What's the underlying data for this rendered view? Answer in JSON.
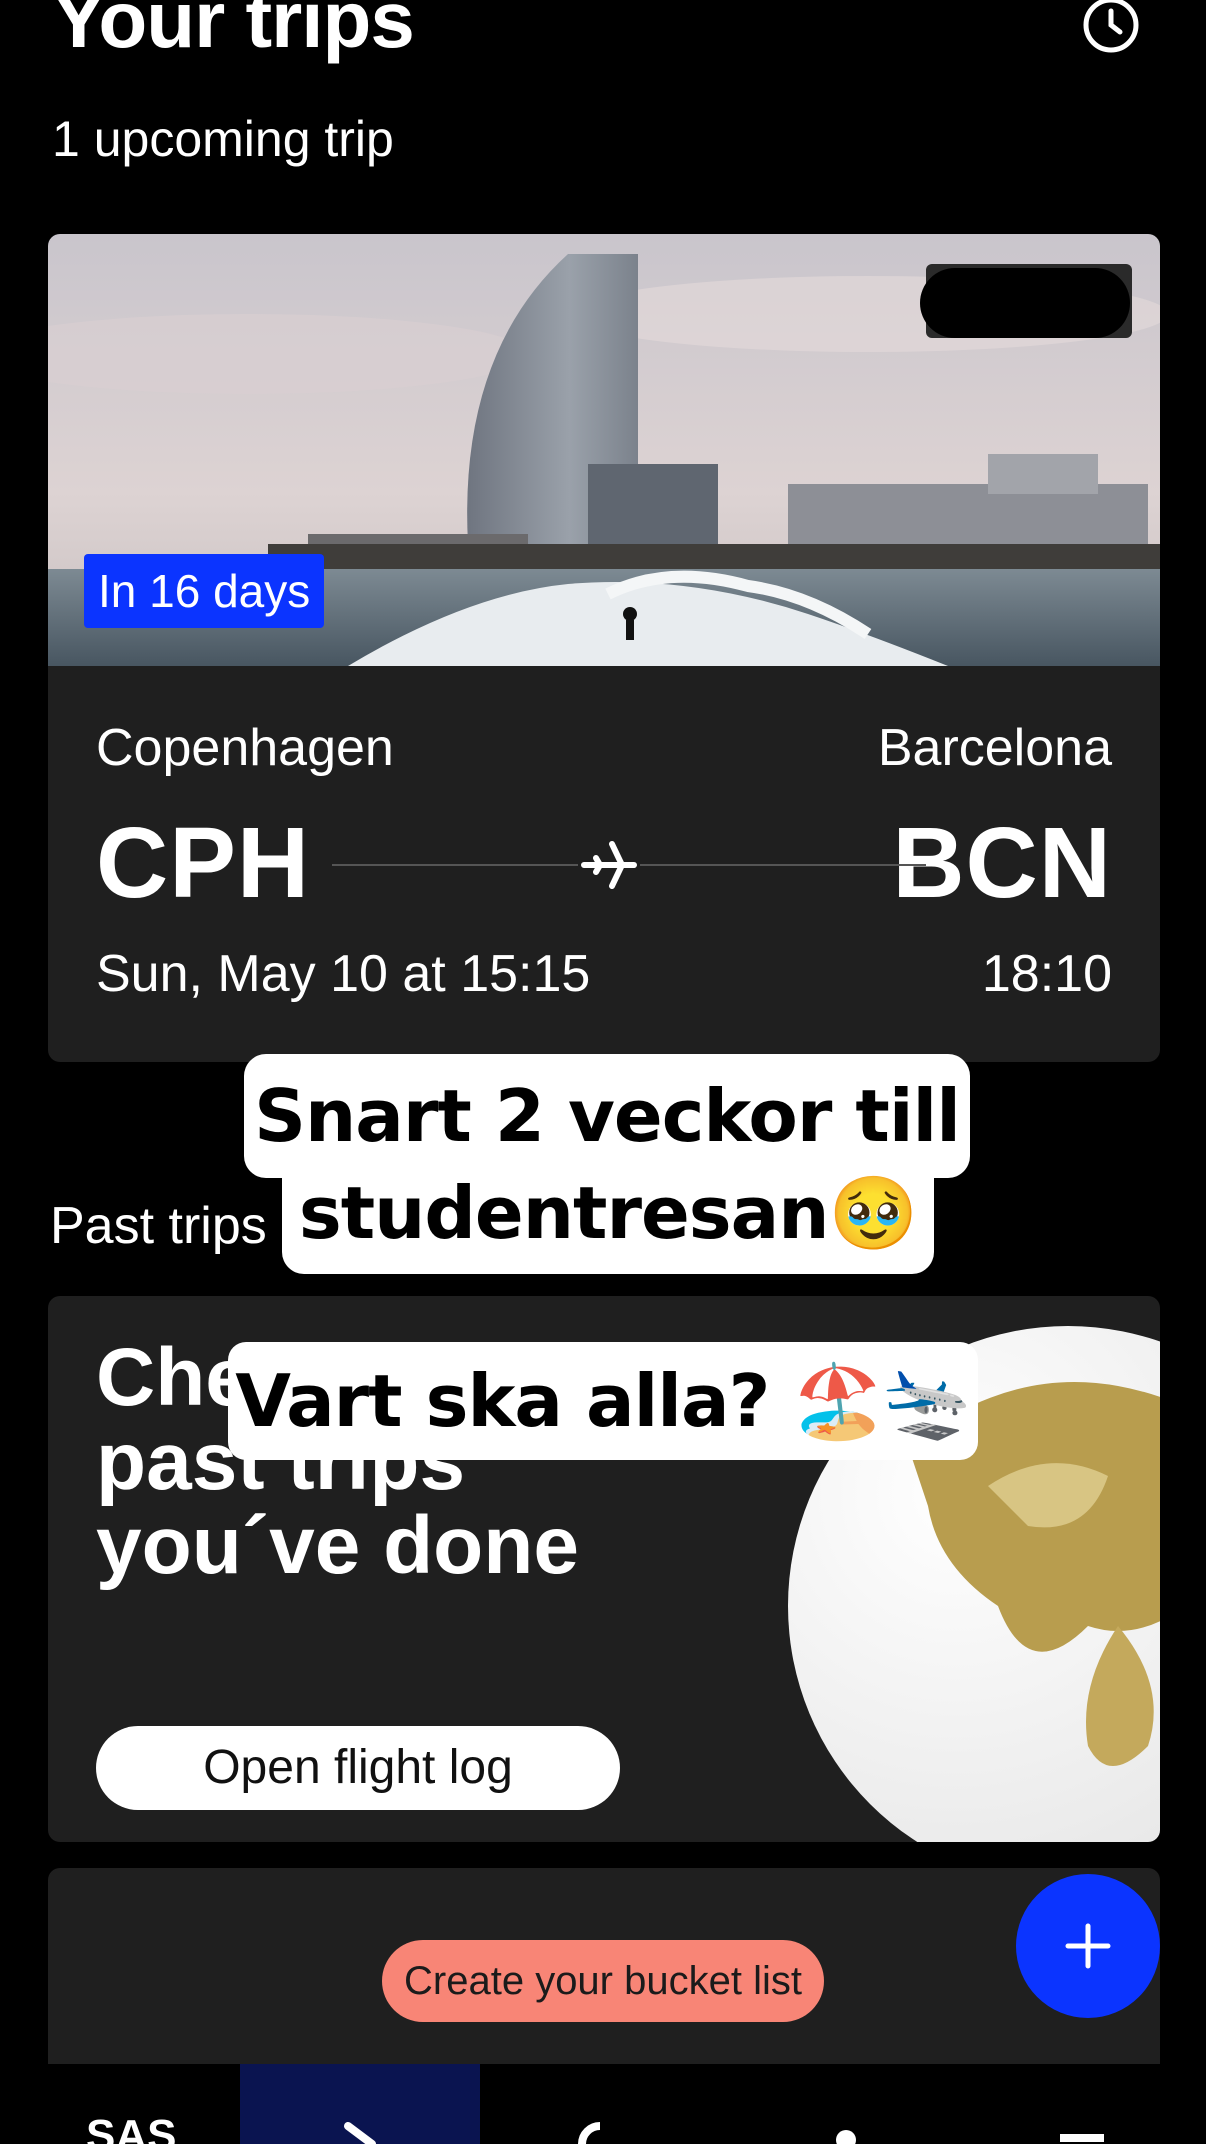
{
  "header": {
    "title": "Your trips",
    "subtitle": "1 upcoming trip",
    "history_icon": "history-icon"
  },
  "upcoming_trip": {
    "countdown": "In 16 days",
    "from_city": "Copenhagen",
    "to_city": "Barcelona",
    "from_code": "CPH",
    "to_code": "BCN",
    "departure": "Sun, May 10 at 15:15",
    "arrival": "18:10",
    "route_icon": "airplane-icon"
  },
  "stickers": {
    "line1": "Snart 2 veckor till",
    "line2": "studentresan🥹",
    "line3": "Vart ska alla? 🏖️🛬"
  },
  "past_trips": {
    "title": "Past trips",
    "promo_text": "Che many past trips you´ve done",
    "button": "Open flight log"
  },
  "bucket_list": {
    "button": "Create your bucket list"
  },
  "fab": {
    "icon": "plus-icon"
  },
  "bottom_nav": {
    "items": [
      "home",
      "trips",
      "search",
      "profile",
      "menu"
    ],
    "active": "trips"
  },
  "colors": {
    "accent_blue": "#0b34ff",
    "bucket_salmon": "#f88576",
    "card_bg": "#1f1f1f"
  }
}
